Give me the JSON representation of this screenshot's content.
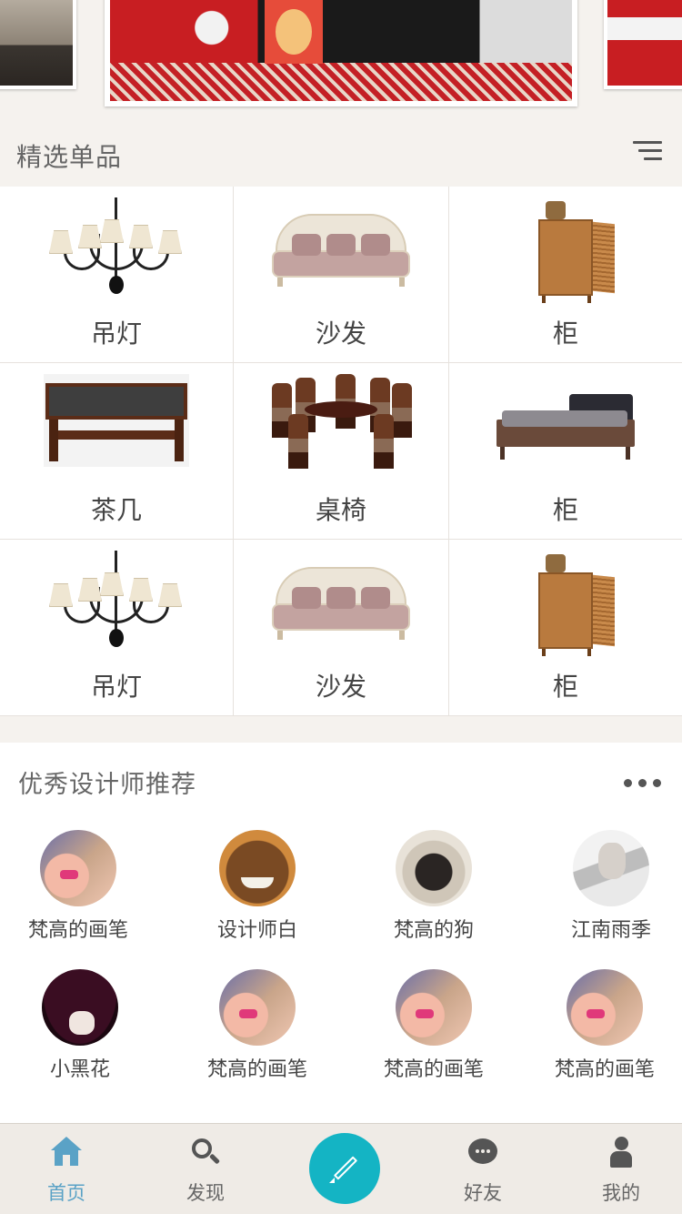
{
  "featured": {
    "title": "精选单品",
    "items": [
      {
        "label": "吊灯",
        "icon": "chandelier"
      },
      {
        "label": "沙发",
        "icon": "sofa"
      },
      {
        "label": "柜",
        "icon": "cabinet"
      },
      {
        "label": "茶几",
        "icon": "coffee-table"
      },
      {
        "label": "桌椅",
        "icon": "dining-set"
      },
      {
        "label": "柜",
        "icon": "bed"
      },
      {
        "label": "吊灯",
        "icon": "chandelier"
      },
      {
        "label": "沙发",
        "icon": "sofa"
      },
      {
        "label": "柜",
        "icon": "cabinet"
      }
    ]
  },
  "designers": {
    "title": "优秀设计师推荐",
    "list": [
      {
        "name": "梵高的画笔",
        "avatar": "girl"
      },
      {
        "name": "设计师白",
        "avatar": "cartoon-man"
      },
      {
        "name": "梵高的狗",
        "avatar": "pug"
      },
      {
        "name": "江南雨季",
        "avatar": "bw-man"
      },
      {
        "name": "小黑花",
        "avatar": "hat-girl"
      },
      {
        "name": "梵高的画笔",
        "avatar": "girl"
      },
      {
        "name": "梵高的画笔",
        "avatar": "girl"
      },
      {
        "name": "梵高的画笔",
        "avatar": "girl"
      }
    ]
  },
  "tabbar": {
    "home": "首页",
    "discover": "发现",
    "friends": "好友",
    "mine": "我的",
    "active": "home",
    "accent": "#5aa2c6",
    "compose_color": "#14b4c4"
  }
}
